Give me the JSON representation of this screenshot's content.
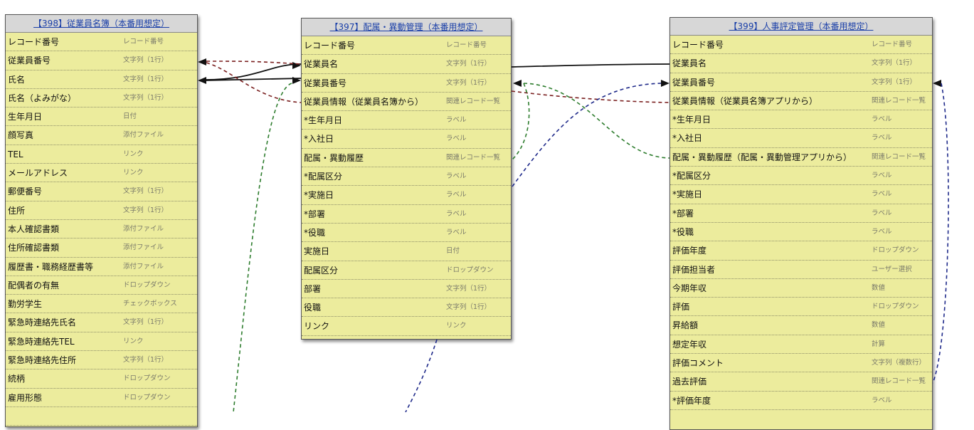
{
  "tables": [
    {
      "id": "t398",
      "title": "【398】従業員名簿（本番用想定）",
      "fields": [
        {
          "name": "レコード番号",
          "type": "レコード番号"
        },
        {
          "name": "従業員番号",
          "type": "文字列（1行）"
        },
        {
          "name": "氏名",
          "type": "文字列（1行）"
        },
        {
          "name": "氏名（よみがな）",
          "type": "文字列（1行）"
        },
        {
          "name": "生年月日",
          "type": "日付"
        },
        {
          "name": "顔写真",
          "type": "添付ファイル"
        },
        {
          "name": "TEL",
          "type": "リンク"
        },
        {
          "name": "メールアドレス",
          "type": "リンク"
        },
        {
          "name": "郵便番号",
          "type": "文字列（1行）"
        },
        {
          "name": "住所",
          "type": "文字列（1行）"
        },
        {
          "name": "本人確認書類",
          "type": "添付ファイル"
        },
        {
          "name": "住所確認書類",
          "type": "添付ファイル"
        },
        {
          "name": "履歴書・職務経歴書等",
          "type": "添付ファイル"
        },
        {
          "name": "配偶者の有無",
          "type": "ドロップダウン"
        },
        {
          "name": "勤労学生",
          "type": "チェックボックス"
        },
        {
          "name": "緊急時連絡先氏名",
          "type": "文字列（1行）"
        },
        {
          "name": "緊急時連絡先TEL",
          "type": "リンク"
        },
        {
          "name": "緊急時連絡先住所",
          "type": "文字列（1行）"
        },
        {
          "name": "続柄",
          "type": "ドロップダウン"
        },
        {
          "name": "雇用形態",
          "type": "ドロップダウン"
        },
        {
          "name": "",
          "type": ""
        }
      ]
    },
    {
      "id": "t397",
      "title": "【397】配属・異動管理（本番用想定）",
      "fields": [
        {
          "name": "レコード番号",
          "type": "レコード番号"
        },
        {
          "name": "従業員名",
          "type": "文字列（1行）"
        },
        {
          "name": "従業員番号",
          "type": "文字列（1行）"
        },
        {
          "name": "従業員情報（従業員名簿から）",
          "type": "関連レコード一覧"
        },
        {
          "name": "*生年月日",
          "type": "ラベル"
        },
        {
          "name": "*入社日",
          "type": "ラベル"
        },
        {
          "name": "配属・異動履歴",
          "type": "関連レコード一覧"
        },
        {
          "name": "*配属区分",
          "type": "ラベル"
        },
        {
          "name": "*実施日",
          "type": "ラベル"
        },
        {
          "name": "*部署",
          "type": "ラベル"
        },
        {
          "name": "*役職",
          "type": "ラベル"
        },
        {
          "name": "実施日",
          "type": "日付"
        },
        {
          "name": "配属区分",
          "type": "ドロップダウン"
        },
        {
          "name": "部署",
          "type": "文字列（1行）"
        },
        {
          "name": "役職",
          "type": "文字列（1行）"
        },
        {
          "name": "リンク",
          "type": "リンク"
        }
      ]
    },
    {
      "id": "t399",
      "title": "【399】人事評定管理（本番用想定）",
      "fields": [
        {
          "name": "レコード番号",
          "type": "レコード番号"
        },
        {
          "name": "従業員名",
          "type": "文字列（1行）"
        },
        {
          "name": "従業員番号",
          "type": "文字列（1行）"
        },
        {
          "name": "従業員情報（従業員名簿アプリから）",
          "type": "関連レコード一覧"
        },
        {
          "name": "*生年月日",
          "type": "ラベル"
        },
        {
          "name": "*入社日",
          "type": "ラベル"
        },
        {
          "name": "配属・異動履歴（配属・異動管理アプリから）",
          "type": "関連レコード一覧"
        },
        {
          "name": "*配属区分",
          "type": "ラベル"
        },
        {
          "name": "*実施日",
          "type": "ラベル"
        },
        {
          "name": "*部署",
          "type": "ラベル"
        },
        {
          "name": "*役職",
          "type": "ラベル"
        },
        {
          "name": "評価年度",
          "type": "ドロップダウン"
        },
        {
          "name": "評価担当者",
          "type": "ユーザー選択"
        },
        {
          "name": "今期年収",
          "type": "数値"
        },
        {
          "name": "評価",
          "type": "ドロップダウン"
        },
        {
          "name": "昇給額",
          "type": "数値"
        },
        {
          "name": "想定年収",
          "type": "計算"
        },
        {
          "name": "評価コメント",
          "type": "文字列（複数行）"
        },
        {
          "name": "過去評価",
          "type": "関連レコード一覧"
        },
        {
          "name": "*評価年度",
          "type": "ラベル"
        }
      ]
    }
  ],
  "link_colors": {
    "lookup": "#111111",
    "related_records_employee": "#7a1f1f",
    "related_records_transfer": "#2e7d2e",
    "related_records_evaluation": "#1f2a8a"
  }
}
